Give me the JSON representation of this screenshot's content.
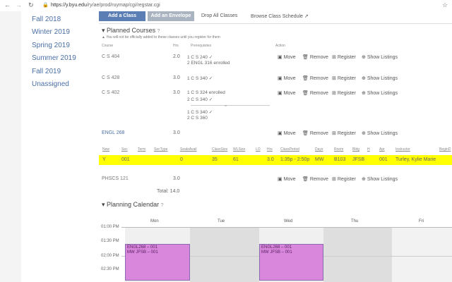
{
  "browser": {
    "url_host": "https://y.byu.edu",
    "url_path": "/ry/ae/prod/ruymap/cgi/regstar.cgi"
  },
  "sidebar": {
    "terms": [
      "Fall 2018",
      "Winter 2019",
      "Spring 2019",
      "Summer 2019",
      "Fall 2019",
      "Unassigned"
    ]
  },
  "toolbar": {
    "add_class": "Add a Class",
    "add_envelope": "Add an Envelope",
    "drop_all": "Drop All Classes",
    "browse": "Browse Class Schedule"
  },
  "planned": {
    "title": "Planned Courses",
    "warning": "You will not be officially added to these classes until you register for them",
    "headers": {
      "course": "Course",
      "hrs": "Hrs",
      "prereq": "Prerequisites",
      "action": "Action"
    },
    "actions": {
      "move": "Move",
      "remove": "Remove",
      "register": "Register",
      "listings": "Show Listings"
    },
    "courses": [
      {
        "course": "C S 404",
        "hrs": "2.0",
        "prereqs": [
          "1 C S 240 ✓",
          "2 ENGL 316 enrolled"
        ]
      },
      {
        "course": "C S 428",
        "hrs": "3.0",
        "prereqs": [
          "1 C S 340 ✓"
        ]
      },
      {
        "course": "C S 402",
        "hrs": "3.0",
        "prereqs": [
          "1 C S 324 enrolled",
          "2 C S 340 ✓",
          "or",
          "1 C S 340 ✓",
          "2 C S 360"
        ]
      },
      {
        "course": "ENGL 268",
        "hrs": "3.0",
        "prereqs": []
      },
      {
        "course": "PHSCS 121",
        "hrs": "3.0",
        "prereqs": []
      }
    ],
    "section_headers": [
      "New",
      "Sec",
      "Term",
      "SecType",
      "SeatsAvail",
      "ClassSize",
      "WLSize",
      "LO",
      "Hrs",
      "ClassPeriod",
      "Days",
      "Room",
      "Bldg",
      "H",
      "Apr",
      "Instructor",
      "BeginD"
    ],
    "section_row": [
      "Y",
      "001",
      "",
      "",
      "0",
      "35",
      "61",
      "",
      "3.0",
      "1:35p - 2:50p",
      "MW",
      "B103",
      "JFSB",
      "",
      "001",
      "Turley, Kylie Marie",
      ""
    ],
    "total": "Total: 14.0"
  },
  "calendar": {
    "title": "Planning Calendar",
    "days": [
      "Mon",
      "Tue",
      "Wed",
      "Thu",
      "Fri"
    ],
    "times": [
      "01:00 PM",
      "01:30 PM",
      "02:00 PM",
      "02:30 PM"
    ],
    "events": [
      {
        "day": "Mon",
        "line1": "ENGL268 – 001",
        "line2": "MW JFSB – 001"
      },
      {
        "day": "Wed",
        "line1": "ENGL268 – 001",
        "line2": "MW JFSB – 001"
      }
    ]
  },
  "colors": {
    "primary": "#5b7fb4",
    "highlight": "#ffff00",
    "event": "#d987dc"
  }
}
